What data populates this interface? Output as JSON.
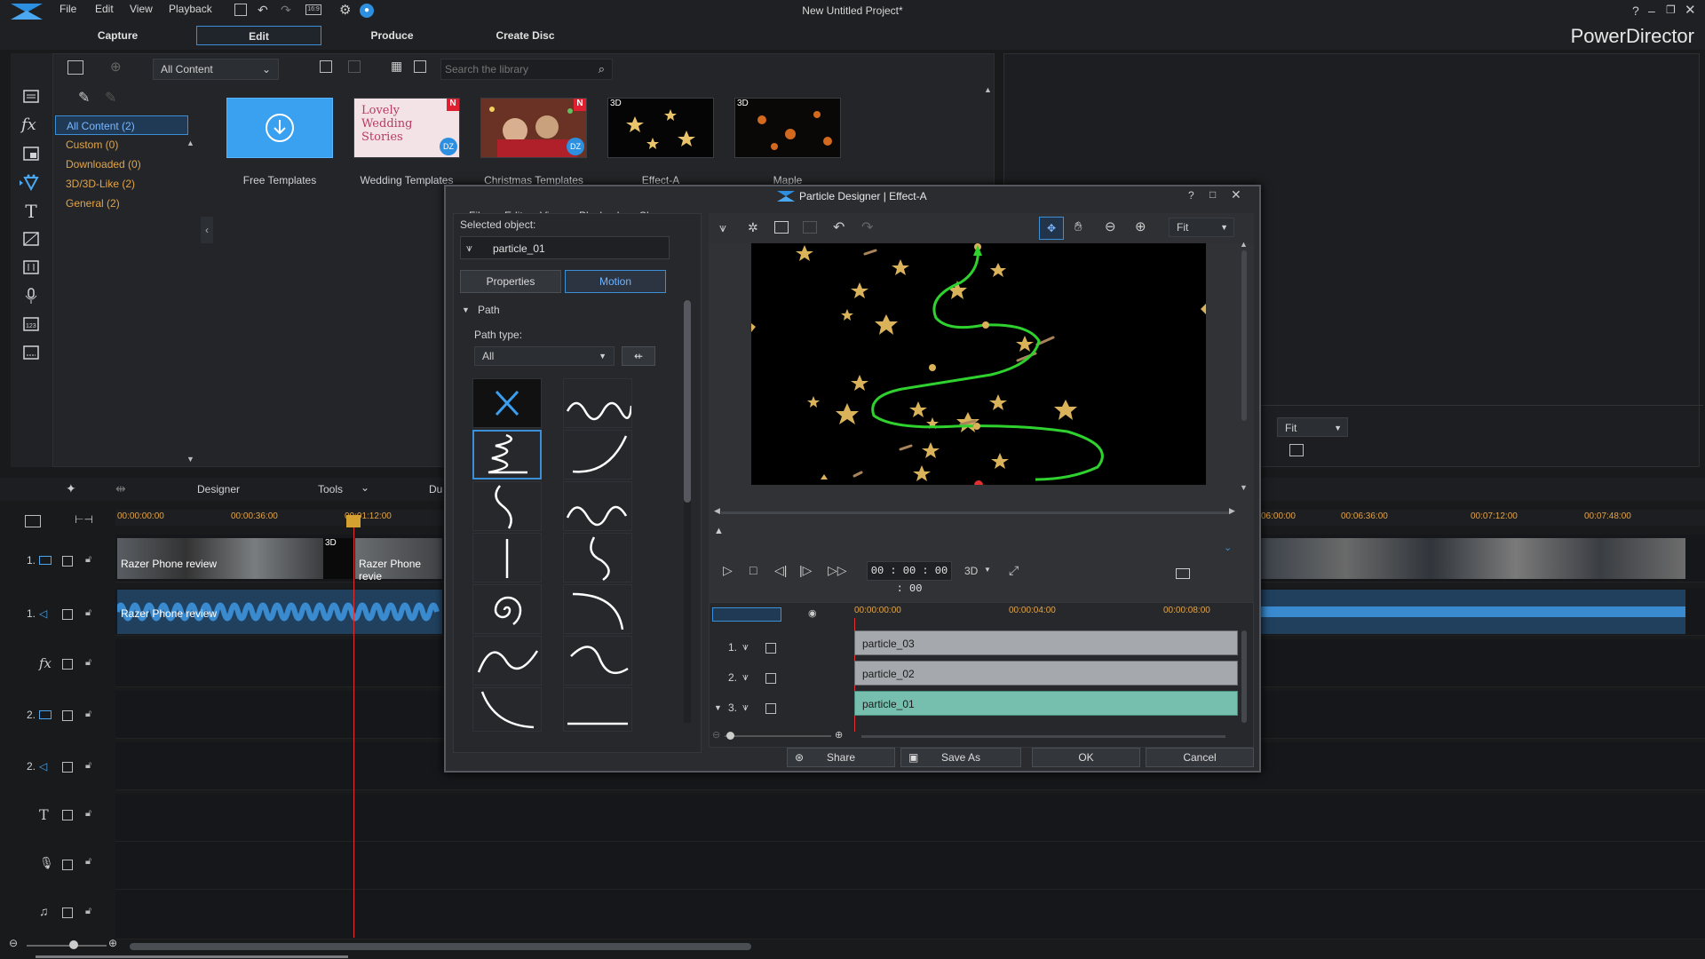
{
  "app": {
    "title": "New Untitled Project*",
    "brand": "PowerDirector"
  },
  "menubar": [
    "File",
    "Edit",
    "View",
    "Playback"
  ],
  "mode_tabs": [
    "Capture",
    "Edit",
    "Produce",
    "Create Disc"
  ],
  "library": {
    "filter_value": "All Content",
    "search_placeholder": "Search the library",
    "categories": [
      "All Content (2)",
      "Custom  (0)",
      "Downloaded  (0)",
      "3D/3D-Like  (2)",
      "General  (2)"
    ],
    "templates": [
      {
        "label": "Free Templates",
        "badge": ""
      },
      {
        "label": "Wedding Templates",
        "badge": "N",
        "overlay": "Lovely Wedding Stories"
      },
      {
        "label": "Christmas Templates",
        "badge": "N"
      },
      {
        "label": "Effect-A",
        "badge": "3D"
      },
      {
        "label": "Maple",
        "badge": "3D"
      }
    ]
  },
  "preview_panel": {
    "zoom": "Fit"
  },
  "timeline_toolbar": {
    "designer": "Designer",
    "tools": "Tools",
    "du": "Du"
  },
  "timeline": {
    "ruler_left": [
      "00:00:00:00",
      "00:00:36:00",
      "00:01:12:00"
    ],
    "ruler_right": [
      "06:00:00",
      "00:06:36:00",
      "00:07:12:00",
      "00:07:48:00"
    ],
    "tracks": [
      "1.",
      "1.",
      "",
      "2.",
      "2.",
      "",
      "",
      ""
    ],
    "clip_video": "Razer Phone review",
    "clip_video2": "Razer Phone revie",
    "clip_audio": "Razer Phone review",
    "clip_3d": "3D"
  },
  "dialog": {
    "title": "Particle Designer  |  Effect-A",
    "menu": [
      "File",
      "Edit",
      "View",
      "Playback",
      "Share"
    ],
    "selected_label": "Selected object:",
    "selected_value": "particle_01",
    "tabs": [
      "Properties",
      "Motion"
    ],
    "section": "Path",
    "path_type_label": "Path type:",
    "path_type_value": "All",
    "zoom_value": "Fit",
    "timecode": "00 : 00 : 00 : 00",
    "mode_3d": "3D",
    "layer_ruler": [
      "00:00:00:00",
      "00:00:04:00",
      "00:00:08:00"
    ],
    "layers": [
      {
        "num": "1.",
        "name": "particle_03"
      },
      {
        "num": "2.",
        "name": "particle_02"
      },
      {
        "num": "3.",
        "name": "particle_01"
      }
    ],
    "buttons": {
      "share": "Share",
      "save_as": "Save As",
      "ok": "OK",
      "cancel": "Cancel"
    }
  },
  "colors": {
    "accent": "#3b8fd6",
    "category": "#e2a54a",
    "path": "#2fd12f",
    "layer_selected": "#76bfae"
  }
}
